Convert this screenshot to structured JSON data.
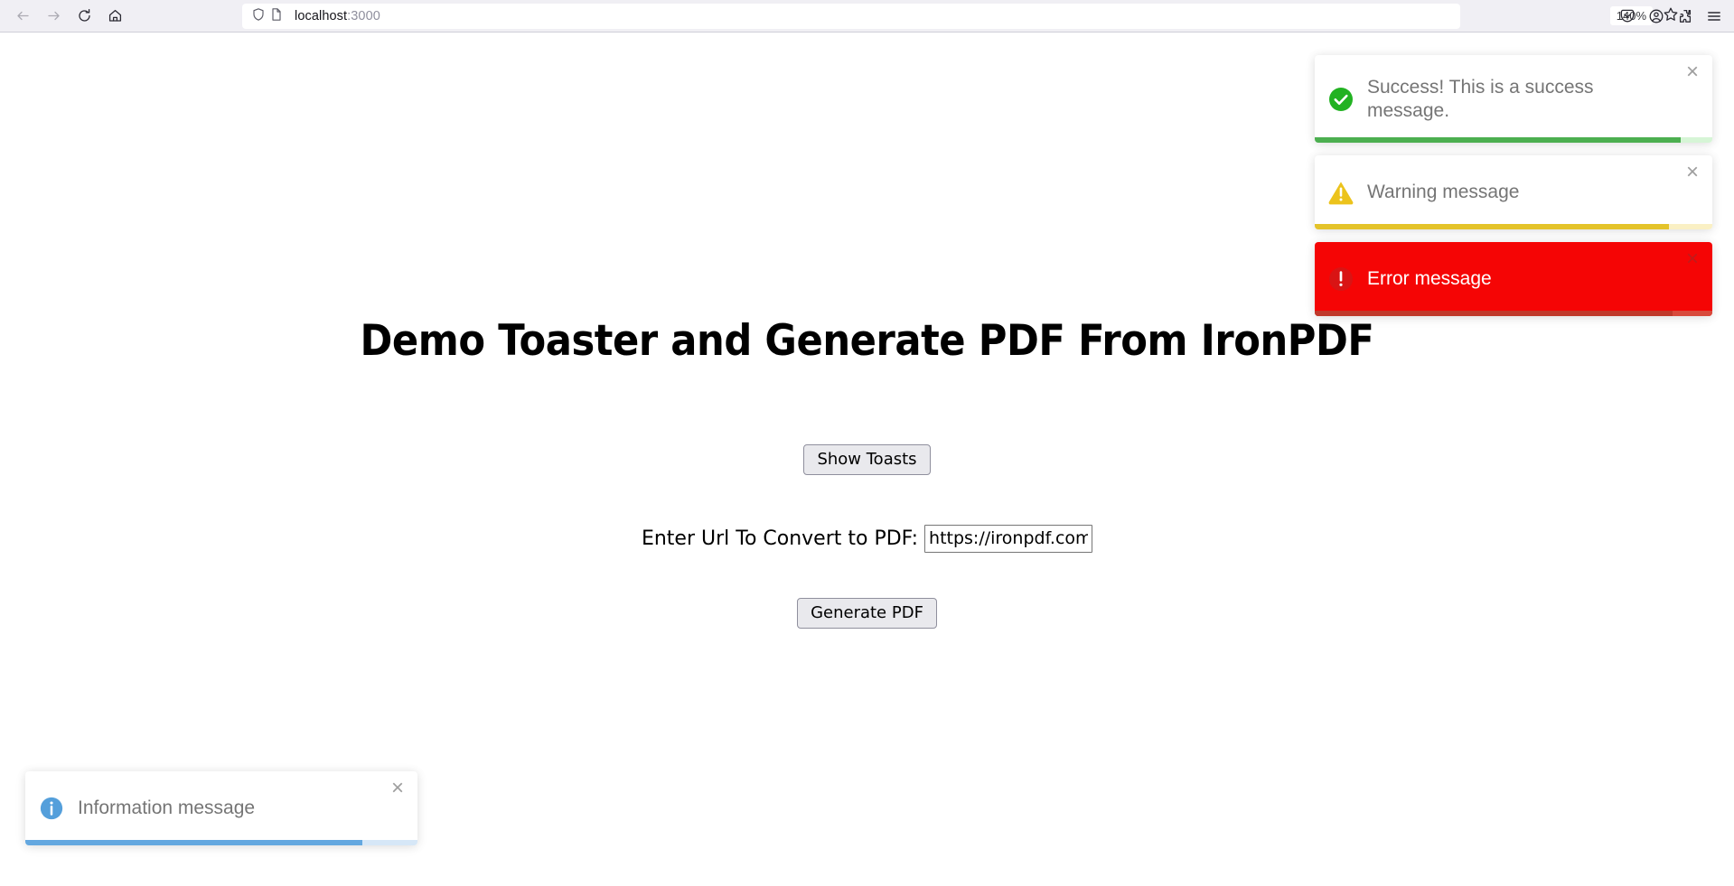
{
  "browser": {
    "nav": {
      "back_label": "Back",
      "forward_label": "Forward",
      "reload_label": "Reload",
      "home_label": "Home"
    },
    "address_bar": {
      "host": "localhost",
      "port": ":3000",
      "shield_icon": "shield-icon",
      "page_icon": "page-document-icon"
    },
    "zoom_level": "140%",
    "toolbar_icons": {
      "bookmark": "star-icon",
      "pocket": "pocket-save-icon",
      "account": "account-circle-icon",
      "extensions": "extensions-puzzle-icon",
      "menu": "hamburger-menu-icon"
    }
  },
  "page": {
    "title": "Demo Toaster and Generate PDF From IronPDF",
    "show_toasts_label": "Show Toasts",
    "url_label": "Enter Url To Convert to PDF:",
    "url_value": "https://ironpdf.com/nodejs",
    "url_placeholder": "",
    "generate_pdf_label": "Generate PDF"
  },
  "toasts": {
    "close_glyph": "×",
    "top_right": [
      {
        "id": "success",
        "message": "Success! This is a success message.",
        "icon": "check-circle-icon",
        "accent": "#4caf50",
        "progress": 92
      },
      {
        "id": "warning",
        "message": "Warning message",
        "icon": "warning-triangle-icon",
        "accent": "#e4c32a",
        "progress": 89
      },
      {
        "id": "error",
        "message": "Error message",
        "icon": "error-circle-icon",
        "accent": "#f50505",
        "progress": 90
      }
    ],
    "bottom_left": [
      {
        "id": "info",
        "message": "Information message",
        "icon": "info-circle-icon",
        "accent": "#64a8e0",
        "progress": 86
      }
    ]
  }
}
